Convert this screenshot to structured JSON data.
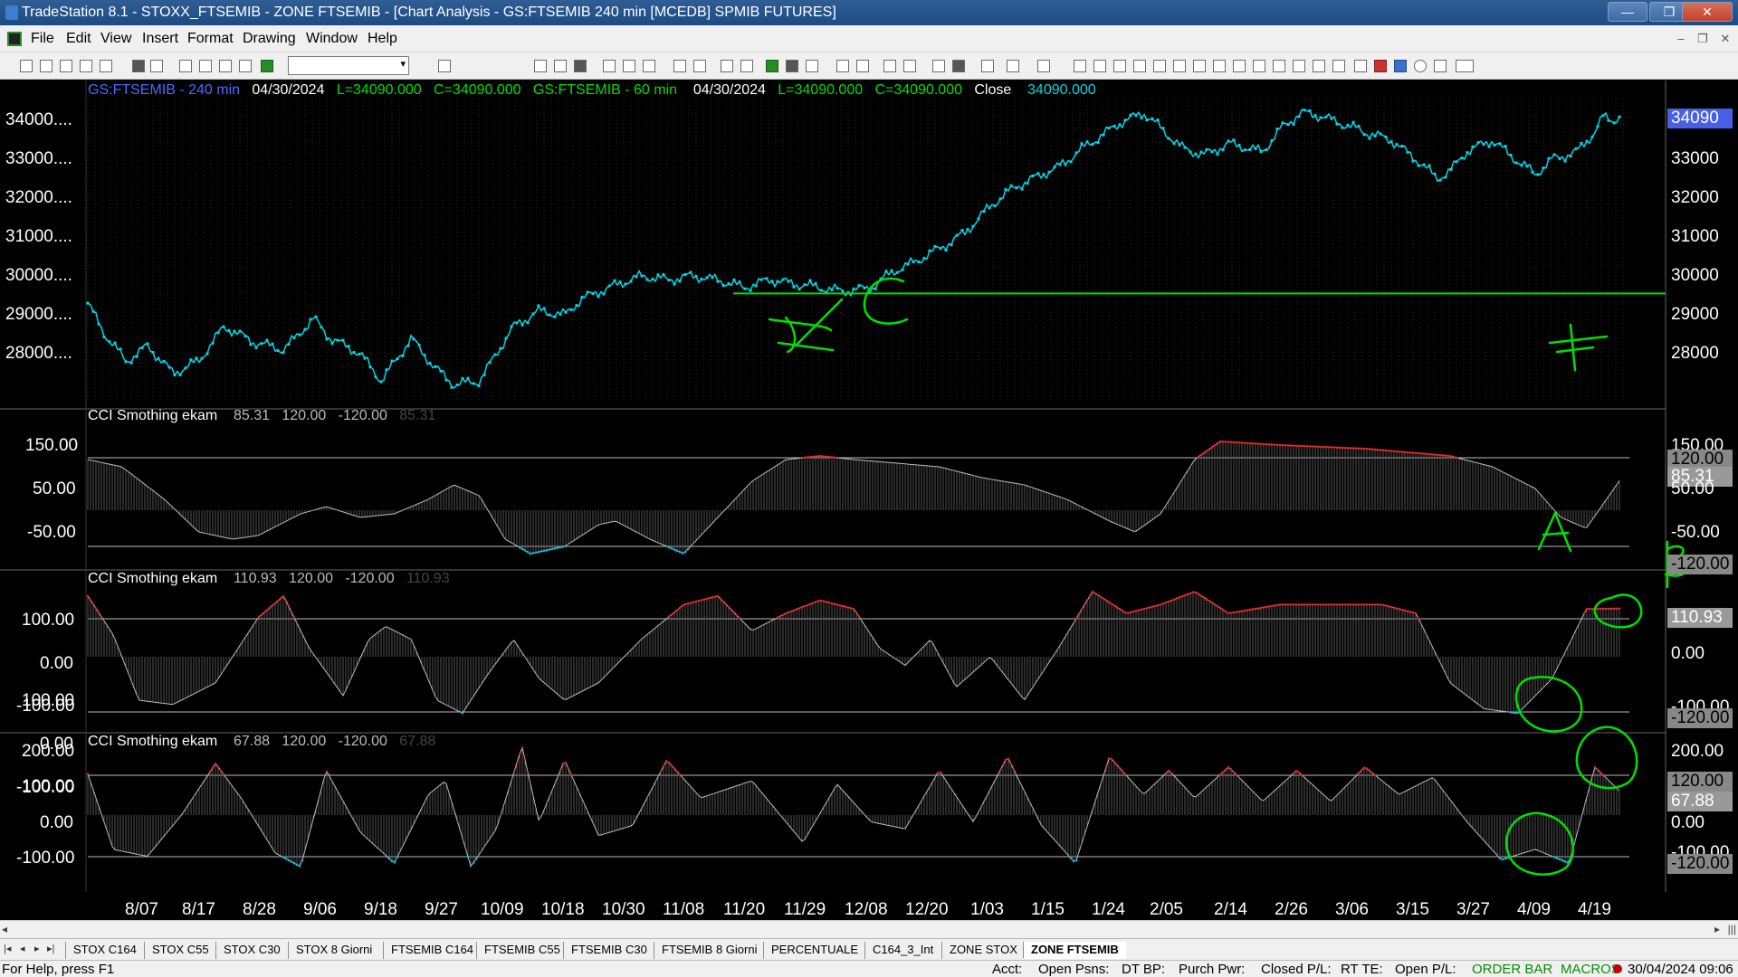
{
  "window": {
    "title": "TradeStation 8.1 - STOXX_FTSEMIB - ZONE FTSEMIB - [Chart Analysis - GS:FTSEMIB  240 min  [MCEDB] SPMIB FUTURES]",
    "minimize": "—",
    "maximize": "❐",
    "close": "✕"
  },
  "menu": {
    "items": [
      "File",
      "Edit",
      "View",
      "Insert",
      "Format",
      "Drawing",
      "Window",
      "Help"
    ],
    "mdi_min": "–",
    "mdi_restore": "❐",
    "mdi_close": "✕"
  },
  "toolbar": {
    "symbol_value": "",
    "combo_arrow": "▾"
  },
  "chart": {
    "header": {
      "sym1": "GS:FTSEMIB - 240 min",
      "date1": "04/30/2024",
      "l1": "L=34090.000",
      "c1": "C=34090.000",
      "sym2": "GS:FTSEMIB - 60 min",
      "date2": "04/30/2024",
      "l2": "L=34090.000",
      "c2": "C=34090.000",
      "close_label": "Close",
      "close_val": "34090.000"
    },
    "price_left_labels": [
      "34000....",
      "33000....",
      "32000....",
      "31000....",
      "30000....",
      "29000....",
      "28000...."
    ],
    "price_right_labels": [
      "33000",
      "32000",
      "31000",
      "30000",
      "29000",
      "28000"
    ],
    "last_price_tag": "34090",
    "colors": {
      "price": "#00d8e8",
      "support": "#00e000",
      "overbought": "#e02020",
      "oversold": "#00c0e0",
      "annotation": "#00e000",
      "panel_title": "#ffffff",
      "header_blue": "#4a6cff",
      "header_green": "#00e000"
    },
    "support_level": 29550
  },
  "panels": [
    {
      "title": "CCI Smothing ekam",
      "value": "85.31",
      "upper": "120.00",
      "lower": "-120.00",
      "value_dim": "85.31",
      "left_labels": [
        "150.00",
        "50.00",
        "-50.00"
      ],
      "right_labels": [
        "150.00",
        "120.00",
        "85.31",
        "50.00",
        "-50.00",
        "-120.00"
      ]
    },
    {
      "title": "CCI Smothing ekam",
      "value": "110.93",
      "upper": "120.00",
      "lower": "-120.00",
      "value_dim": "110.93",
      "left_labels": [
        "100.00",
        "0.00",
        "-100.00"
      ],
      "right_labels": [
        "110.93",
        "0.00",
        "-100.00",
        "-120.00"
      ]
    },
    {
      "title": "CCI Smothing ekam",
      "value": "67.88",
      "upper": "120.00",
      "lower": "-120.00",
      "value_dim": "67.88",
      "left_labels": [
        "200.00",
        "100.00",
        "0.00",
        "-100.00"
      ],
      "right_labels": [
        "200.00",
        "120.00",
        "67.88",
        "0.00",
        "-100.00",
        "-120.00"
      ]
    }
  ],
  "dates": [
    "8/07",
    "8/17",
    "8/28",
    "9/06",
    "9/18",
    "9/27",
    "10/09",
    "10/18",
    "10/30",
    "11/08",
    "11/20",
    "11/29",
    "12/08",
    "12/20",
    "1/03",
    "1/15",
    "1/24",
    "2/05",
    "2/14",
    "2/26",
    "3/06",
    "3/15",
    "3/27",
    "4/09",
    "4/19"
  ],
  "tabs": [
    "STOX C164",
    "STOX C55",
    "STOX  C30",
    "STOX  8 Giorni",
    "FTSEMIB C164",
    "FTSEMIB C55",
    "FTSEMIB C30",
    "FTSEMIB  8 Giorni",
    "PERCENTUALE",
    "C164_3_Int",
    "ZONE STOX",
    "ZONE FTSEMIB"
  ],
  "active_tab": "ZONE FTSEMIB",
  "tab_nav": [
    "|◂",
    "◂",
    "▸",
    "▸|"
  ],
  "scroll": {
    "left": "◂",
    "right": "▸",
    "grip": "|||"
  },
  "status": {
    "help": "For Help, press F1",
    "acct": "Acct:",
    "open_psns": "Open Psns:",
    "dt_bp": "DT BP:",
    "purch_pwr": "Purch Pwr:",
    "closed_pl": "Closed P/L:",
    "rt_te": "RT TE:",
    "open_pl": "Open P/L:",
    "order_bar": "ORDER BAR",
    "macros": "MACROS",
    "datetime": "30/04/2024 09:06"
  }
}
